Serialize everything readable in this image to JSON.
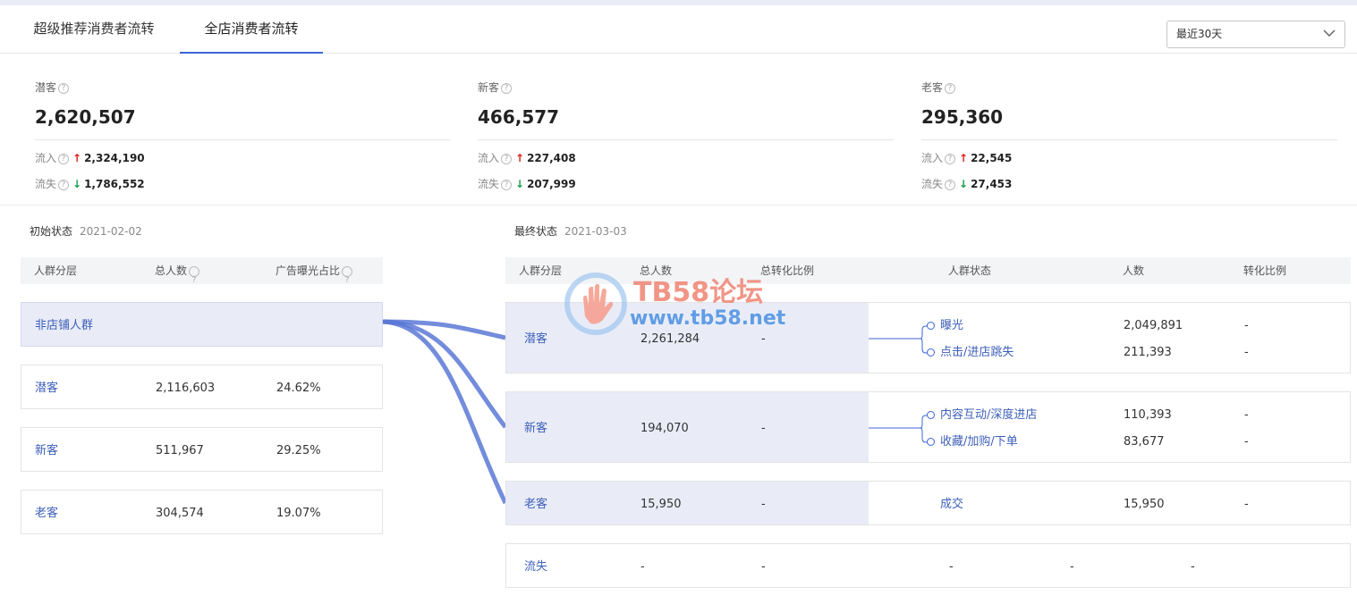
{
  "tabs": [
    {
      "label": "超级推荐消费者流转"
    },
    {
      "label": "全店消费者流转"
    }
  ],
  "date_select": {
    "value": "最近30天"
  },
  "stats": [
    {
      "label": "潜客",
      "value": "2,620,507",
      "inflow_label": "流入",
      "inflow": "2,324,190",
      "outflow_label": "流失",
      "outflow": "1,786,552"
    },
    {
      "label": "新客",
      "value": "466,577",
      "inflow_label": "流入",
      "inflow": "227,408",
      "outflow_label": "流失",
      "outflow": "207,999"
    },
    {
      "label": "老客",
      "value": "295,360",
      "inflow_label": "流入",
      "inflow": "22,545",
      "outflow_label": "流失",
      "outflow": "27,453"
    }
  ],
  "initial": {
    "title": "初始状态",
    "date": "2021-02-02",
    "headers": [
      "人群分层",
      "总人数",
      "广告曝光占比"
    ],
    "rows": [
      {
        "name": "非店铺人群",
        "total": "",
        "ratio": ""
      },
      {
        "name": "潜客",
        "total": "2,116,603",
        "ratio": "24.62%"
      },
      {
        "name": "新客",
        "total": "511,967",
        "ratio": "29.25%"
      },
      {
        "name": "老客",
        "total": "304,574",
        "ratio": "19.07%"
      }
    ]
  },
  "final": {
    "title": "最终状态",
    "date": "2021-03-03",
    "headers": [
      "人群分层",
      "总人数",
      "总转化比例",
      "人群状态",
      "人数",
      "转化比例"
    ],
    "rows": [
      {
        "name": "潜客",
        "total": "2,261,284",
        "conv": "-",
        "states": [
          {
            "name": "曝光",
            "count": "2,049,891",
            "conv": "-"
          },
          {
            "name": "点击/进店跳失",
            "count": "211,393",
            "conv": "-"
          }
        ]
      },
      {
        "name": "新客",
        "total": "194,070",
        "conv": "-",
        "states": [
          {
            "name": "内容互动/深度进店",
            "count": "110,393",
            "conv": "-"
          },
          {
            "name": "收藏/加购/下单",
            "count": "83,677",
            "conv": "-"
          }
        ]
      },
      {
        "name": "老客",
        "total": "15,950",
        "conv": "-",
        "states": [
          {
            "name": "成交",
            "count": "15,950",
            "conv": "-"
          }
        ]
      },
      {
        "name": "流失",
        "total": "-",
        "conv": "-",
        "states": [
          {
            "name": "-",
            "count": "-",
            "conv": "-"
          }
        ]
      }
    ]
  },
  "watermark": {
    "line1": "TB58论坛",
    "line2": "www.tb58.net"
  },
  "colors": {
    "accent": "#3d64d8",
    "flow": "#5b78d6",
    "up": "#d9201b",
    "down": "#1a9c4a"
  }
}
